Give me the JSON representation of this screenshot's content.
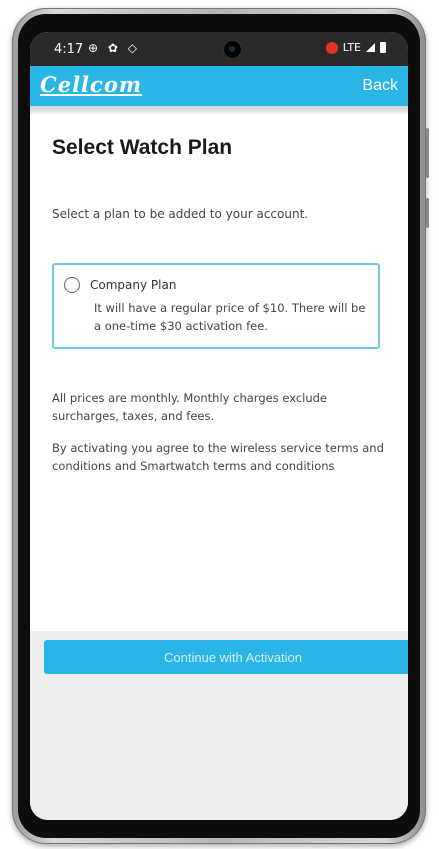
{
  "status_bar": {
    "time": "4:17",
    "left_icons": "⊕ ✿ ◇",
    "right_text": "LTE"
  },
  "app_bar": {
    "logo": "Cellcom",
    "back_label": "Back"
  },
  "page": {
    "title": "Select Watch Plan",
    "subtitle": "Select a plan to be added to your account."
  },
  "plans": [
    {
      "name": "Company Plan",
      "description": "It will have a regular price of $10. There will be a one-time $30 activation fee.",
      "selected": false
    }
  ],
  "notes": {
    "pricing": "All prices are monthly. Monthly charges exclude surcharges, taxes, and fees.",
    "agreement": "By activating you agree to the wireless service terms and conditions and Smartwatch terms and conditions"
  },
  "actions": {
    "continue_label": "Continue with Activation"
  },
  "colors": {
    "brand": "#29b6e6",
    "card_border": "#6cc8ea"
  }
}
